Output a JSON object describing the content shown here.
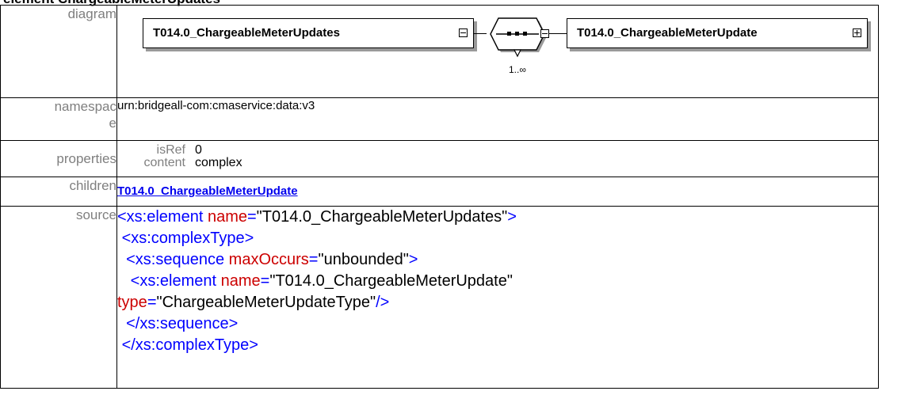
{
  "page": {
    "title": "element ChargeableMeterUpdates"
  },
  "labels": {
    "diagram": "diagram",
    "namespace_line1": "namespac",
    "namespace_line2": "e",
    "properties": "properties",
    "children": "children",
    "source": "source"
  },
  "diagram": {
    "parent_element": "T014.0_ChargeableMeterUpdates",
    "child_element": "T014.0_ChargeableMeterUpdate",
    "compositor": "sequence",
    "multiplicity": "1..∞",
    "icons": [
      "collapse-icon",
      "sequence-compositor-icon",
      "collapse-icon",
      "expand-icon"
    ]
  },
  "namespace": "urn:bridgeall-com:cmaservice:data:v3",
  "properties": [
    {
      "key": "isRef",
      "value": "0"
    },
    {
      "key": "content",
      "value": "complex"
    }
  ],
  "children": [
    "T014.0_ChargeableMeterUpdate"
  ],
  "source": {
    "l1_tag": "<xs:element",
    "l1_attr": " name",
    "l1_eq": "=",
    "l1_val": "\"T014.0_ChargeableMeterUpdates\"",
    "l1_close": ">",
    "l2": "<xs:complexType>",
    "l3_tag": "<xs:sequence",
    "l3_attr": " maxOccurs",
    "l3_eq": "=",
    "l3_val": "\"unbounded\"",
    "l3_close": ">",
    "l4_tag": "<xs:element",
    "l4_attr": " name",
    "l4_eq": "=",
    "l4_val": "\"T014.0_ChargeableMeterUpdate\"",
    "l5_attr": "type",
    "l5_eq": "=",
    "l5_val": "\"ChargeableMeterUpdateType\"",
    "l5_close": "/>",
    "l6": "</xs:sequence>",
    "l7": "</xs:complexType>"
  }
}
